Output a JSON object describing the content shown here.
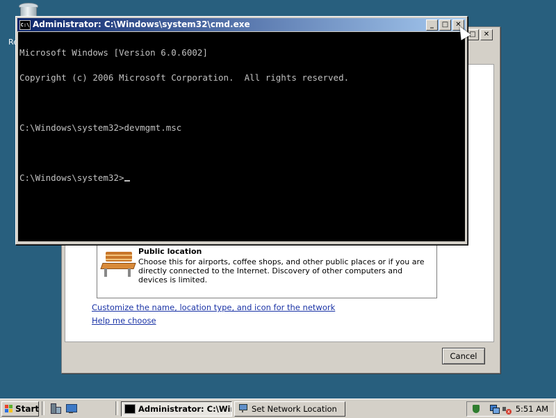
{
  "desktop": {
    "recycle_bin_label": "Re"
  },
  "network_dialog": {
    "public_location_title": "Public location",
    "public_location_desc": "Choose this for airports, coffee shops, and other public places or if you are directly connected to the Internet. Discovery of other computers and devices is limited.",
    "customize_link": "Customize the name, location type, and icon for the network",
    "help_link": "Help me choose",
    "cancel_label": "Cancel"
  },
  "cmd_window": {
    "title": "Administrator: C:\\Windows\\system32\\cmd.exe",
    "icon_text": "C:\\",
    "minimize_glyph": "_",
    "maximize_glyph": "□",
    "close_glyph": "✕",
    "console_lines": [
      "Microsoft Windows [Version 6.0.6002]",
      "Copyright (c) 2006 Microsoft Corporation.  All rights reserved.",
      "",
      "C:\\Windows\\system32>devmgmt.msc",
      "",
      "C:\\Windows\\system32>"
    ]
  },
  "taskbar": {
    "start_label": "Start",
    "tasks": [
      {
        "label": "Administrator: C:\\Win...",
        "active": true,
        "icon": "cmd-icon"
      },
      {
        "label": "Set Network Location",
        "active": false,
        "icon": "network-icon"
      }
    ],
    "clock": "5:51 AM"
  },
  "colors": {
    "desktop": "#285f7e",
    "titlebar_start": "#0a246a",
    "titlebar_end": "#a6caf0",
    "link": "#1a33a6"
  }
}
